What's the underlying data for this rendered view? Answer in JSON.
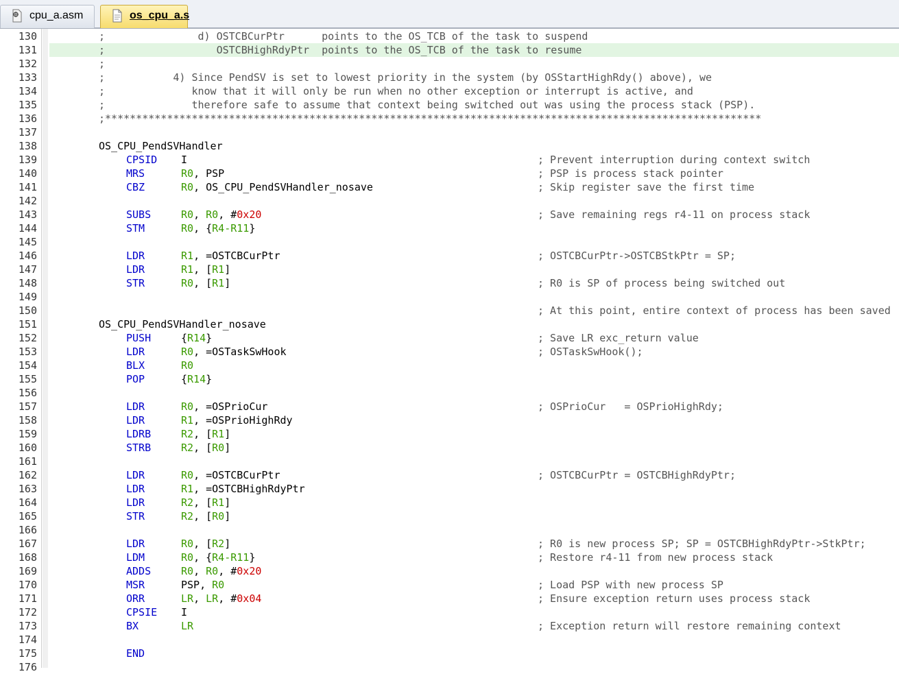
{
  "tabs": [
    {
      "label": "cpu_a.asm",
      "active": false,
      "icon": "asm-file-icon"
    },
    {
      "label": "os_cpu_a.s",
      "active": true,
      "icon": "source-file-icon"
    }
  ],
  "colors": {
    "opcode": "#0000cc",
    "register": "#3a9a00",
    "number": "#cc0000",
    "comment": "#555555",
    "highlight": "#e2f5e2"
  },
  "lines": [
    {
      "n": "130",
      "full": ";               d) OSTCBCurPtr      points to the OS_TCB of the task to suspend"
    },
    {
      "n": "131",
      "full": ";                  OSTCBHighRdyPtr  points to the OS_TCB of the task to resume",
      "hl": true
    },
    {
      "n": "132",
      "full": ";"
    },
    {
      "n": "133",
      "full": ";           4) Since PendSV is set to lowest priority in the system (by OSStartHighRdy() above), we"
    },
    {
      "n": "134",
      "full": ";              know that it will only be run when no other exception or interrupt is active, and"
    },
    {
      "n": "135",
      "full": ";              therefore safe to assume that context being switched out was using the process stack (PSP)."
    },
    {
      "n": "136",
      "full": ";**********************************************************************************************************"
    },
    {
      "n": "137"
    },
    {
      "n": "138",
      "label": "OS_CPU_PendSVHandler"
    },
    {
      "n": "139",
      "op": "CPSID",
      "args": [
        {
          "t": "I",
          "c": "plain"
        }
      ],
      "cm": "; Prevent interruption during context switch"
    },
    {
      "n": "140",
      "op": "MRS",
      "args": [
        {
          "t": "R0",
          "c": "reg"
        },
        {
          "t": ", PSP",
          "c": "plain"
        }
      ],
      "cm": "; PSP is process stack pointer"
    },
    {
      "n": "141",
      "op": "CBZ",
      "args": [
        {
          "t": "R0",
          "c": "reg"
        },
        {
          "t": ", OS_CPU_PendSVHandler_nosave",
          "c": "plain"
        }
      ],
      "cm": "; Skip register save the first time"
    },
    {
      "n": "142"
    },
    {
      "n": "143",
      "op": "SUBS",
      "args": [
        {
          "t": "R0",
          "c": "reg"
        },
        {
          "t": ", ",
          "c": "plain"
        },
        {
          "t": "R0",
          "c": "reg"
        },
        {
          "t": ", #",
          "c": "plain"
        },
        {
          "t": "0x20",
          "c": "num"
        }
      ],
      "cm": "; Save remaining regs r4-11 on process stack"
    },
    {
      "n": "144",
      "op": "STM",
      "args": [
        {
          "t": "R0",
          "c": "reg"
        },
        {
          "t": ", {",
          "c": "plain"
        },
        {
          "t": "R4-R11",
          "c": "reg"
        },
        {
          "t": "}",
          "c": "plain"
        }
      ]
    },
    {
      "n": "145"
    },
    {
      "n": "146",
      "op": "LDR",
      "args": [
        {
          "t": "R1",
          "c": "reg"
        },
        {
          "t": ", =OSTCBCurPtr",
          "c": "plain"
        }
      ],
      "cm": "; OSTCBCurPtr->OSTCBStkPtr = SP;"
    },
    {
      "n": "147",
      "op": "LDR",
      "args": [
        {
          "t": "R1",
          "c": "reg"
        },
        {
          "t": ", [",
          "c": "plain"
        },
        {
          "t": "R1",
          "c": "reg"
        },
        {
          "t": "]",
          "c": "plain"
        }
      ]
    },
    {
      "n": "148",
      "op": "STR",
      "args": [
        {
          "t": "R0",
          "c": "reg"
        },
        {
          "t": ", [",
          "c": "plain"
        },
        {
          "t": "R1",
          "c": "reg"
        },
        {
          "t": "]",
          "c": "plain"
        }
      ],
      "cm": "; R0 is SP of process being switched out"
    },
    {
      "n": "149"
    },
    {
      "n": "150",
      "cm": "; At this point, entire context of process has been saved"
    },
    {
      "n": "151",
      "label": "OS_CPU_PendSVHandler_nosave"
    },
    {
      "n": "152",
      "op": "PUSH",
      "args": [
        {
          "t": "{",
          "c": "plain"
        },
        {
          "t": "R14",
          "c": "reg"
        },
        {
          "t": "}",
          "c": "plain"
        }
      ],
      "cm": "; Save LR exc_return value"
    },
    {
      "n": "153",
      "op": "LDR",
      "args": [
        {
          "t": "R0",
          "c": "reg"
        },
        {
          "t": ", =OSTaskSwHook",
          "c": "plain"
        }
      ],
      "cm": "; OSTaskSwHook();"
    },
    {
      "n": "154",
      "op": "BLX",
      "args": [
        {
          "t": "R0",
          "c": "reg"
        }
      ]
    },
    {
      "n": "155",
      "op": "POP",
      "args": [
        {
          "t": "{",
          "c": "plain"
        },
        {
          "t": "R14",
          "c": "reg"
        },
        {
          "t": "}",
          "c": "plain"
        }
      ]
    },
    {
      "n": "156"
    },
    {
      "n": "157",
      "op": "LDR",
      "args": [
        {
          "t": "R0",
          "c": "reg"
        },
        {
          "t": ", =OSPrioCur",
          "c": "plain"
        }
      ],
      "cm": "; OSPrioCur   = OSPrioHighRdy;"
    },
    {
      "n": "158",
      "op": "LDR",
      "args": [
        {
          "t": "R1",
          "c": "reg"
        },
        {
          "t": ", =OSPrioHighRdy",
          "c": "plain"
        }
      ]
    },
    {
      "n": "159",
      "op": "LDRB",
      "args": [
        {
          "t": "R2",
          "c": "reg"
        },
        {
          "t": ", [",
          "c": "plain"
        },
        {
          "t": "R1",
          "c": "reg"
        },
        {
          "t": "]",
          "c": "plain"
        }
      ]
    },
    {
      "n": "160",
      "op": "STRB",
      "args": [
        {
          "t": "R2",
          "c": "reg"
        },
        {
          "t": ", [",
          "c": "plain"
        },
        {
          "t": "R0",
          "c": "reg"
        },
        {
          "t": "]",
          "c": "plain"
        }
      ]
    },
    {
      "n": "161"
    },
    {
      "n": "162",
      "op": "LDR",
      "args": [
        {
          "t": "R0",
          "c": "reg"
        },
        {
          "t": ", =OSTCBCurPtr",
          "c": "plain"
        }
      ],
      "cm": "; OSTCBCurPtr = OSTCBHighRdyPtr;"
    },
    {
      "n": "163",
      "op": "LDR",
      "args": [
        {
          "t": "R1",
          "c": "reg"
        },
        {
          "t": ", =OSTCBHighRdyPtr",
          "c": "plain"
        }
      ]
    },
    {
      "n": "164",
      "op": "LDR",
      "args": [
        {
          "t": "R2",
          "c": "reg"
        },
        {
          "t": ", [",
          "c": "plain"
        },
        {
          "t": "R1",
          "c": "reg"
        },
        {
          "t": "]",
          "c": "plain"
        }
      ]
    },
    {
      "n": "165",
      "op": "STR",
      "args": [
        {
          "t": "R2",
          "c": "reg"
        },
        {
          "t": ", [",
          "c": "plain"
        },
        {
          "t": "R0",
          "c": "reg"
        },
        {
          "t": "]",
          "c": "plain"
        }
      ]
    },
    {
      "n": "166"
    },
    {
      "n": "167",
      "op": "LDR",
      "args": [
        {
          "t": "R0",
          "c": "reg"
        },
        {
          "t": ", [",
          "c": "plain"
        },
        {
          "t": "R2",
          "c": "reg"
        },
        {
          "t": "]",
          "c": "plain"
        }
      ],
      "cm": "; R0 is new process SP; SP = OSTCBHighRdyPtr->StkPtr;"
    },
    {
      "n": "168",
      "op": "LDM",
      "args": [
        {
          "t": "R0",
          "c": "reg"
        },
        {
          "t": ", {",
          "c": "plain"
        },
        {
          "t": "R4-R11",
          "c": "reg"
        },
        {
          "t": "}",
          "c": "plain"
        }
      ],
      "cm": "; Restore r4-11 from new process stack"
    },
    {
      "n": "169",
      "op": "ADDS",
      "args": [
        {
          "t": "R0",
          "c": "reg"
        },
        {
          "t": ", ",
          "c": "plain"
        },
        {
          "t": "R0",
          "c": "reg"
        },
        {
          "t": ", #",
          "c": "plain"
        },
        {
          "t": "0x20",
          "c": "num"
        }
      ]
    },
    {
      "n": "170",
      "op": "MSR",
      "args": [
        {
          "t": "PSP, ",
          "c": "plain"
        },
        {
          "t": "R0",
          "c": "reg"
        }
      ],
      "cm": "; Load PSP with new process SP"
    },
    {
      "n": "171",
      "op": "ORR",
      "args": [
        {
          "t": "LR",
          "c": "reg"
        },
        {
          "t": ", ",
          "c": "plain"
        },
        {
          "t": "LR",
          "c": "reg"
        },
        {
          "t": ", #",
          "c": "plain"
        },
        {
          "t": "0x04",
          "c": "num"
        }
      ],
      "cm": "; Ensure exception return uses process stack"
    },
    {
      "n": "172",
      "op": "CPSIE",
      "args": [
        {
          "t": "I",
          "c": "plain"
        }
      ]
    },
    {
      "n": "173",
      "op": "BX",
      "args": [
        {
          "t": "LR",
          "c": "reg"
        }
      ],
      "cm": "; Exception return will restore remaining context"
    },
    {
      "n": "174"
    },
    {
      "n": "175",
      "op": "END"
    },
    {
      "n": "176"
    }
  ]
}
